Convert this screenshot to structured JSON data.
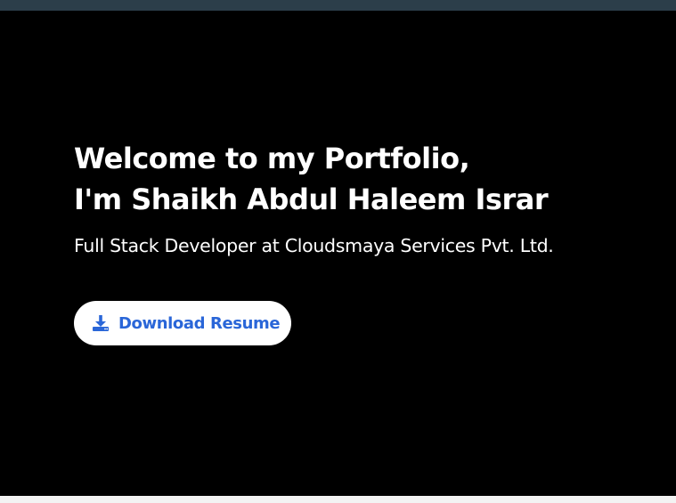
{
  "hero": {
    "title_line1": "Welcome to my Portfolio,",
    "title_line2": "I'm Shaikh Abdul Haleem Israr",
    "subtitle": "Full Stack Developer at Cloudsmaya Services Pvt. Ltd.",
    "download_button": {
      "label": "Download Resume",
      "icon": "download-icon"
    }
  },
  "colors": {
    "background": "#000000",
    "top_bar": "#2c3e4a",
    "text": "#ffffff",
    "button_background": "#ffffff",
    "button_text": "#2a66d8"
  }
}
